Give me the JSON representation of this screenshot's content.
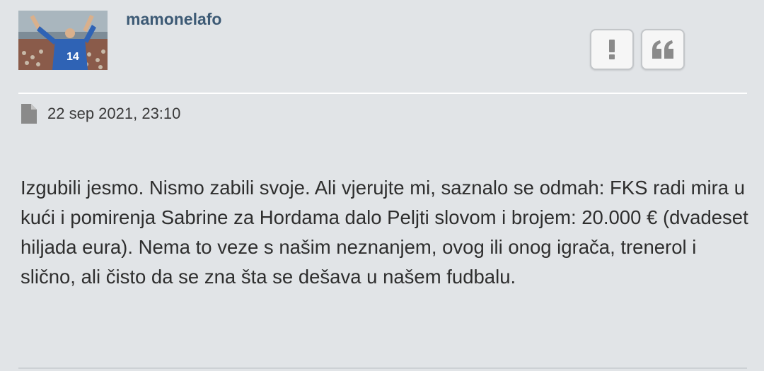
{
  "post": {
    "author": "mamonelafo",
    "avatar_icon": "user-avatar-football-player",
    "date": "22 sep 2021, 23:10",
    "body": "Izgubili jesmo. Nismo zabili svoje. Ali vjerujte mi, saznalo se odmah: FKS radi mira u kući i pomirenja Sabrine za Hordama dalo Peljti slovom i brojem: 20.000 € (dvadeset hiljada eura). Nema to veze s našim neznanjem, ovog ili onog igrača, trenerol i slično, ali čisto da se zna šta se dešava u našem fudbalu."
  },
  "actions": {
    "report_icon": "exclamation-icon",
    "quote_icon": "quote-icon"
  },
  "colors": {
    "background": "#e1e4e7",
    "username": "#3d5a75",
    "body_text": "#2e2e2e"
  }
}
